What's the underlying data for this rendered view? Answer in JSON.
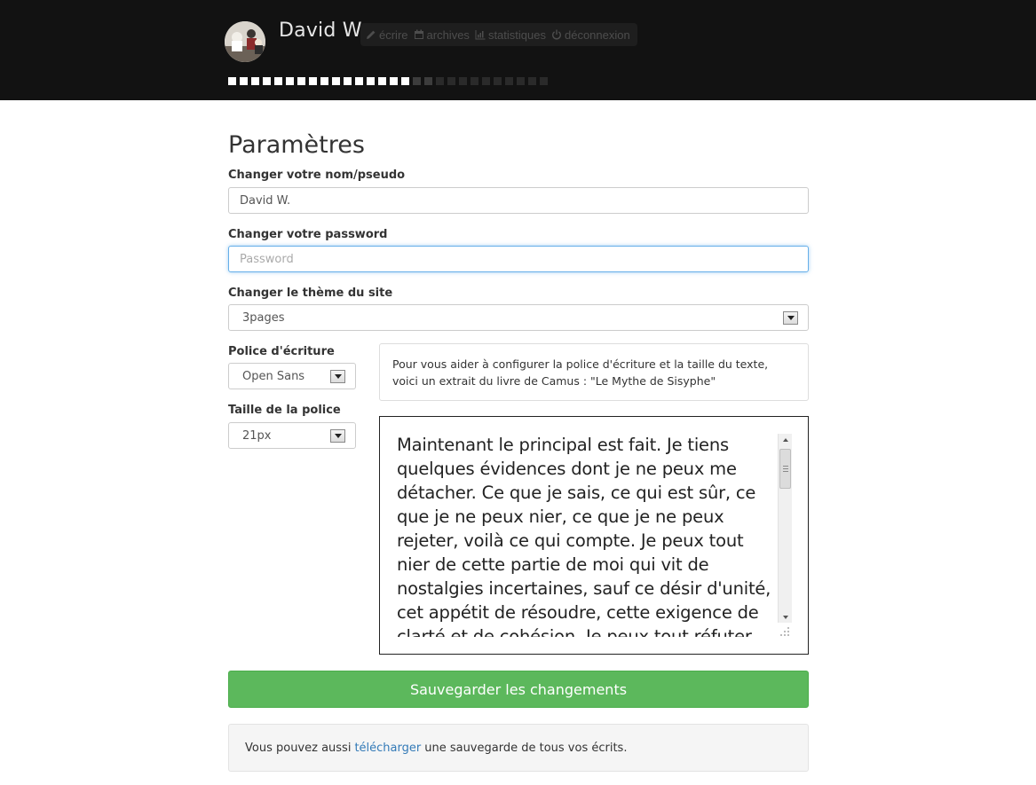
{
  "header": {
    "username": "David W.",
    "nav": [
      {
        "label": "écrire",
        "icon": "pencil-icon"
      },
      {
        "label": "archives",
        "icon": "calendar-icon"
      },
      {
        "label": "statistiques",
        "icon": "bar-chart-icon"
      },
      {
        "label": "déconnexion",
        "icon": "power-icon"
      }
    ],
    "progress": {
      "filled": 16,
      "partial": 2,
      "total": 28
    }
  },
  "page": {
    "title": "Paramètres",
    "name_label": "Changer votre nom/pseudo",
    "name_value": "David W.",
    "password_label": "Changer votre password",
    "password_placeholder": "Password",
    "theme_label": "Changer le thème du site",
    "theme_value": "3pages",
    "font_label": "Police d'écriture",
    "font_value": "Open Sans",
    "size_label": "Taille de la police",
    "size_value": "21px",
    "info_text": "Pour vous aider à configurer la police d'écriture et la taille du texte, voici un extrait du livre de Camus : \"Le Mythe de Sisyphe\"",
    "preview_text": "Maintenant le principal est fait. Je tiens quelques évidences dont je ne peux me détacher. Ce que je sais, ce qui est sûr, ce que je ne peux nier, ce que je ne peux rejeter, voilà ce qui compte. Je peux tout nier de cette partie de moi qui vit de nostalgies incertaines, sauf ce désir d'unité, cet appétit de résoudre, cette exigence de clarté et de cohésion. Je peux tout réfuter dans ce monde qui",
    "save_label": "Sauvegarder les changements",
    "note_before": "Vous pouvez aussi",
    "note_link": "télécharger",
    "note_after": "une sauvegarde de tous vos écrits."
  },
  "colors": {
    "header_bg": "#121212",
    "save_green": "#5cb85c",
    "link_blue": "#337ab7",
    "focus_blue": "#66afe9"
  }
}
